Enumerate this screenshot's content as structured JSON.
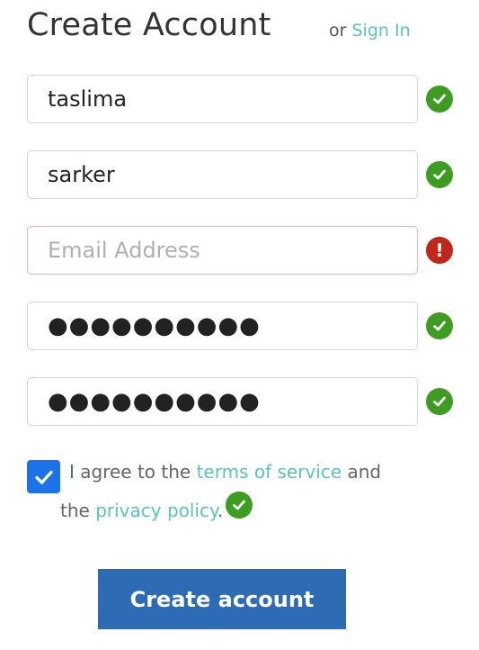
{
  "header": {
    "title": "Create Account",
    "or_text": "or",
    "signin_label": "Sign In"
  },
  "form": {
    "first_name": {
      "value": "taslima",
      "status": "valid"
    },
    "last_name": {
      "value": "sarker",
      "status": "valid"
    },
    "email": {
      "value": "",
      "placeholder": "Email Address",
      "status": "error"
    },
    "password": {
      "masked": "●●●●●●●●●●",
      "status": "valid"
    },
    "confirm_password": {
      "masked": "●●●●●●●●●●",
      "status": "valid"
    }
  },
  "agreement": {
    "checked": true,
    "text_before": "I agree to the",
    "terms_label": "terms of service",
    "text_and": "and",
    "text_the": "the",
    "privacy_label": "privacy policy",
    "text_period": ".",
    "status": "valid"
  },
  "submit": {
    "label": "Create account"
  },
  "icons": {
    "valid": "check-circle-icon",
    "error": "exclamation-circle-icon",
    "checkbox": "checkmark-icon"
  },
  "colors": {
    "link": "#5bc2c2",
    "valid": "#3d9d21",
    "error": "#c1261b",
    "checkbox": "#1a73e8",
    "button": "#2d6bb5"
  }
}
